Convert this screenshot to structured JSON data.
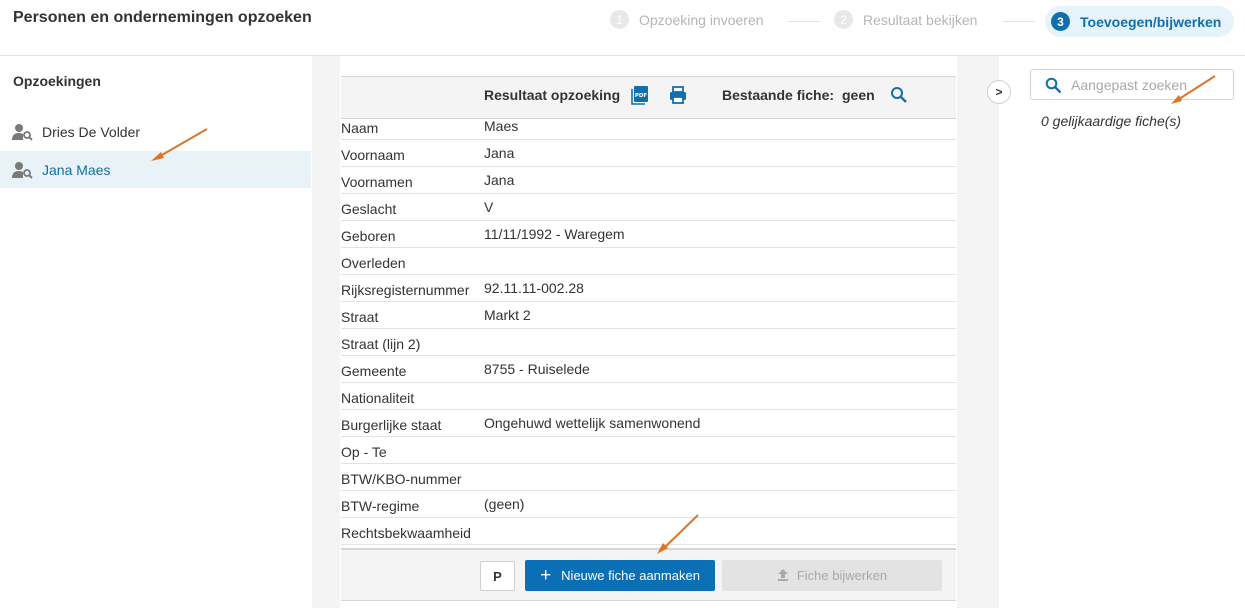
{
  "header": {
    "title": "Personen en ondernemingen opzoeken",
    "steps": [
      {
        "num": "1",
        "label": "Opzoeking invoeren"
      },
      {
        "num": "2",
        "label": "Resultaat bekijken"
      },
      {
        "num": "3",
        "label": "Toevoegen/bijwerken"
      }
    ]
  },
  "sidebar": {
    "title": "Opzoekingen",
    "items": [
      {
        "label": "Dries De Volder"
      },
      {
        "label": "Jana Maes"
      }
    ]
  },
  "result": {
    "heading": "Resultaat opzoeking",
    "existing_label": "Bestaande fiche:",
    "existing_value": "geen",
    "rows": [
      {
        "label": "Naam",
        "value": "Maes"
      },
      {
        "label": "Voornaam",
        "value": "Jana"
      },
      {
        "label": "Voornamen",
        "value": "Jana"
      },
      {
        "label": "Geslacht",
        "value": "V"
      },
      {
        "label": "Geboren",
        "value": "11/11/1992 - Waregem"
      },
      {
        "label": "Overleden",
        "value": ""
      },
      {
        "label": "Rijksregisternummer",
        "value": "92.11.11-002.28"
      },
      {
        "label": "Straat",
        "value": "Markt 2"
      },
      {
        "label": "Straat (lijn 2)",
        "value": ""
      },
      {
        "label": "Gemeente",
        "value": "8755 - Ruiselede"
      },
      {
        "label": "Nationaliteit",
        "value": ""
      },
      {
        "label": "Burgerlijke staat",
        "value": "Ongehuwd wettelijk samenwonend"
      },
      {
        "label": "Op - Te",
        "value": ""
      },
      {
        "label": "BTW/KBO-nummer",
        "value": ""
      },
      {
        "label": "BTW-regime",
        "value": "(geen)"
      },
      {
        "label": "Rechtsbekwaamheid",
        "value": ""
      }
    ]
  },
  "footer": {
    "p_label": "P",
    "new_label": "Nieuwe fiche aanmaken",
    "update_label": "Fiche bijwerken"
  },
  "right": {
    "toggle": ">",
    "search_placeholder": "Aangepast zoeken",
    "similar_text": "0 gelijkaardige fiche(s)"
  },
  "colors": {
    "accent": "#1170aa",
    "primary_button": "#0a6fb5",
    "annotation_arrow": "#d9762b"
  }
}
